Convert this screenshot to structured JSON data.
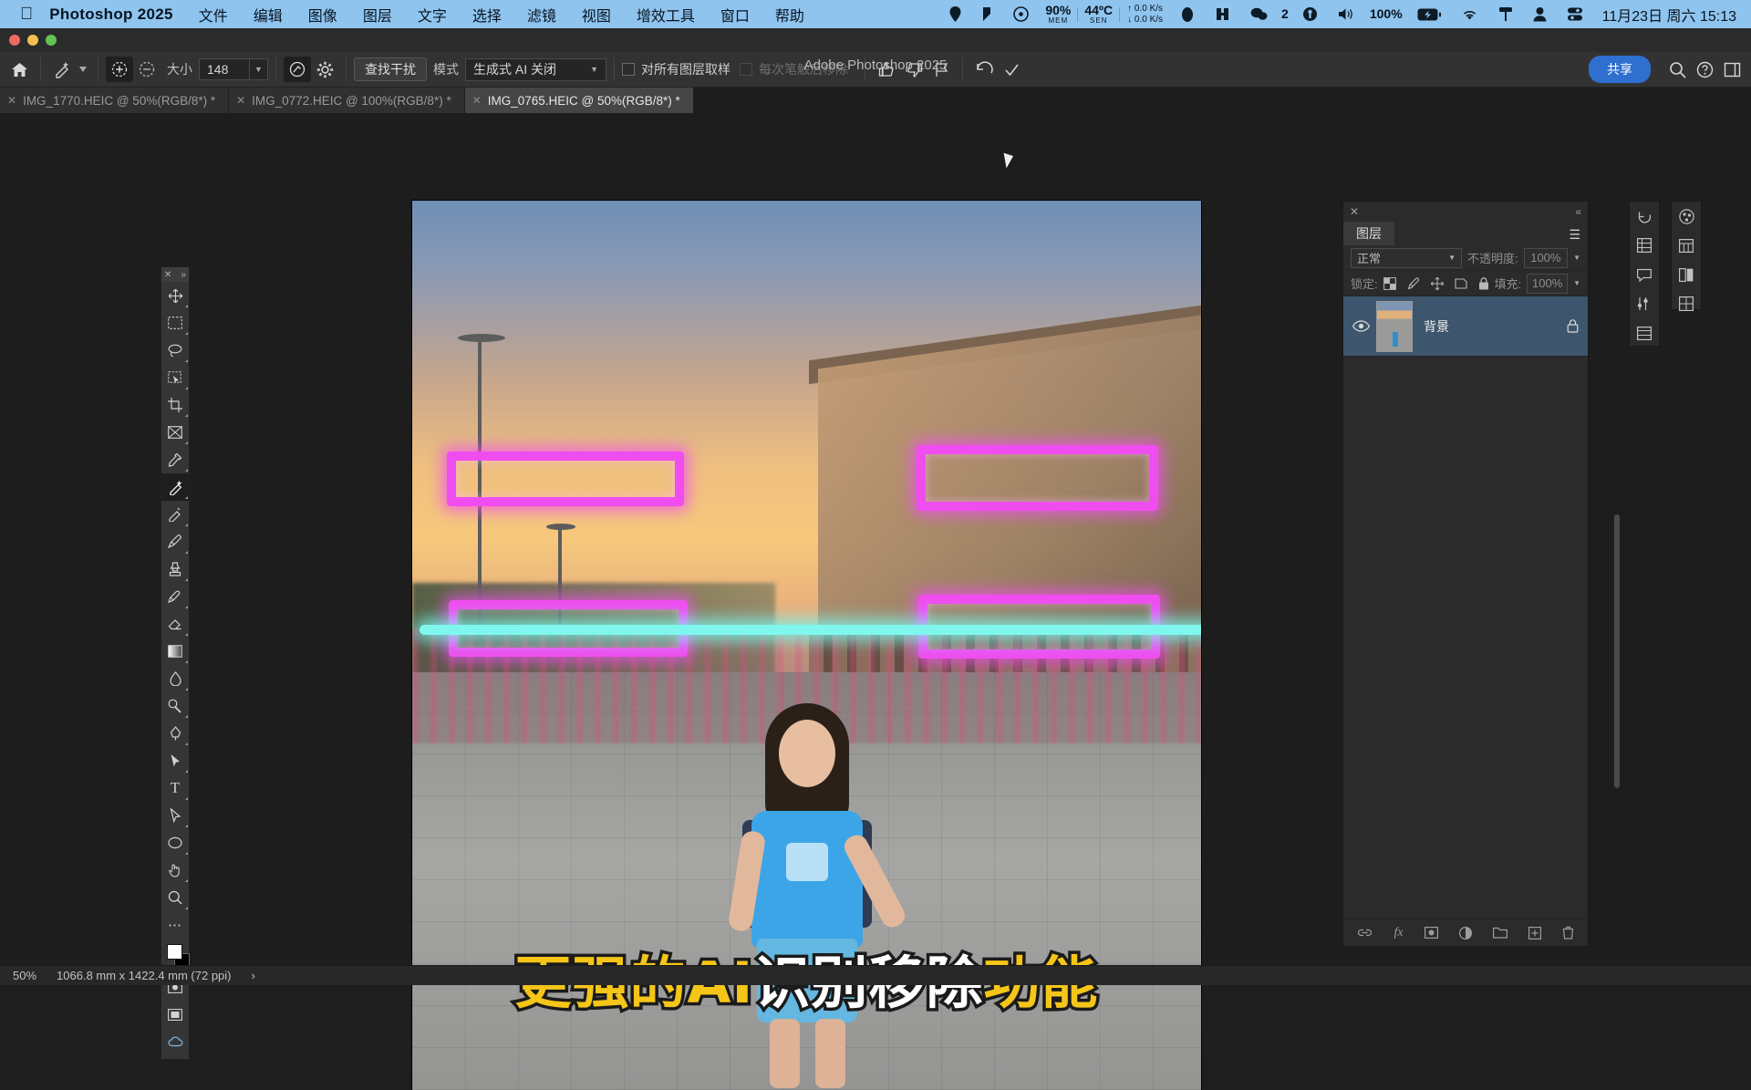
{
  "macbar": {
    "apple_icon": "apple-icon",
    "app_name": "Photoshop 2025",
    "menus": [
      "文件",
      "编辑",
      "图像",
      "图层",
      "文字",
      "选择",
      "滤镜",
      "视图",
      "增效工具",
      "窗口",
      "帮助"
    ],
    "status": {
      "mem_value": "90%",
      "mem_label": "MEM",
      "sen_value": "44ºC",
      "sen_label": "SEN",
      "net_up": "↑ 0.0 K/s",
      "net_down": "↓ 0.0 K/s",
      "badge_count": "2",
      "battery_percent": "100%"
    },
    "clock": "11月23日 周六  15:13"
  },
  "window": {
    "title": "Adobe Photoshop 2025"
  },
  "options_bar": {
    "home_icon": "home-icon",
    "tool_icon": "remove-tool-icon",
    "add_icon": "brush-add-icon",
    "subtract_icon": "brush-subtract-icon",
    "size_label": "大小",
    "size_value": "148",
    "pressure_icon": "pressure-icon",
    "settings_icon": "gear-icon",
    "find_distractions_label": "查找干扰",
    "mode_label": "模式",
    "mode_value": "生成式 AI 关闭",
    "sample_all_layers_label": "对所有图层取样",
    "remove_after_stroke_label": "每次笔触后移除",
    "thumbs_up_icon": "thumbs-up-icon",
    "thumbs_down_icon": "thumbs-down-icon",
    "flag_icon": "flag-icon",
    "undo_icon": "undo-icon",
    "check_icon": "check-icon",
    "share_label": "共享",
    "search_icon": "search-icon",
    "help_icon": "help-icon",
    "workspace_icon": "workspace-icon"
  },
  "tabs": [
    {
      "label": "IMG_1770.HEIC @ 50%(RGB/8*) *",
      "active": false
    },
    {
      "label": "IMG_0772.HEIC @ 100%(RGB/8*) *",
      "active": false
    },
    {
      "label": "IMG_0765.HEIC @ 50%(RGB/8*) *",
      "active": true
    }
  ],
  "toolbar": {
    "close_icon": "close-icon",
    "expand_icon": "expand-icon",
    "tools": [
      "move-tool",
      "marquee-tool",
      "lasso-tool",
      "object-select-tool",
      "crop-tool",
      "frame-tool",
      "eyedropper-tool",
      "remove-tool",
      "healing-brush-tool",
      "brush-tool",
      "clone-stamp-tool",
      "history-brush-tool",
      "eraser-tool",
      "gradient-tool",
      "blur-tool",
      "dodge-tool",
      "pen-tool",
      "path-select-tool",
      "type-tool",
      "direct-select-tool",
      "shape-tool",
      "hand-tool",
      "zoom-tool",
      "more-tools"
    ],
    "foreground_color": "#ffffff",
    "background_color": "#000000",
    "quickmask_icon": "quick-mask-icon",
    "screenmode_icon": "screen-mode-icon",
    "cloud_icon": "cloud-documents-icon"
  },
  "canvas": {
    "caption_part1": "更强的AI",
    "caption_part2": "识别移除",
    "caption_part3": "功能",
    "caption_color_yellow": "#f5c518",
    "caption_color_white": "#ffffff",
    "selection_color": "#f04df0",
    "guide_color": "#7ff7ef"
  },
  "layers_panel": {
    "close_icon": "close-icon",
    "collapse_icon": "collapse-icon",
    "tab_label": "图层",
    "menu_icon": "panel-menu-icon",
    "blend_mode": "正常",
    "opacity_label": "不透明度:",
    "opacity_value": "100%",
    "lock_label": "锁定:",
    "lock_icons": [
      "lock-transparent-icon",
      "lock-image-icon",
      "lock-position-icon",
      "lock-artboard-icon",
      "lock-all-icon"
    ],
    "fill_label": "填充:",
    "fill_value": "100%",
    "layers": [
      {
        "name": "背景",
        "visible_icon": "eye-icon",
        "lock_icon": "lock-icon",
        "selected": true
      }
    ],
    "footer_icons": [
      "link-icon",
      "fx-icon",
      "mask-icon",
      "adjustment-icon",
      "group-icon",
      "new-layer-icon",
      "delete-icon"
    ]
  },
  "right_rail": {
    "column_a": [
      "history-icon",
      "grid-icon",
      "comment-icon",
      "adjustments-icon",
      "properties-icon"
    ],
    "column_b": [
      "color-icon",
      "libraries-icon",
      "swatches-icon",
      "patterns-icon"
    ]
  },
  "status_bar": {
    "zoom": "50%",
    "dimensions": "1066.8 mm x 1422.4 mm (72 ppi)",
    "expander": "›"
  }
}
